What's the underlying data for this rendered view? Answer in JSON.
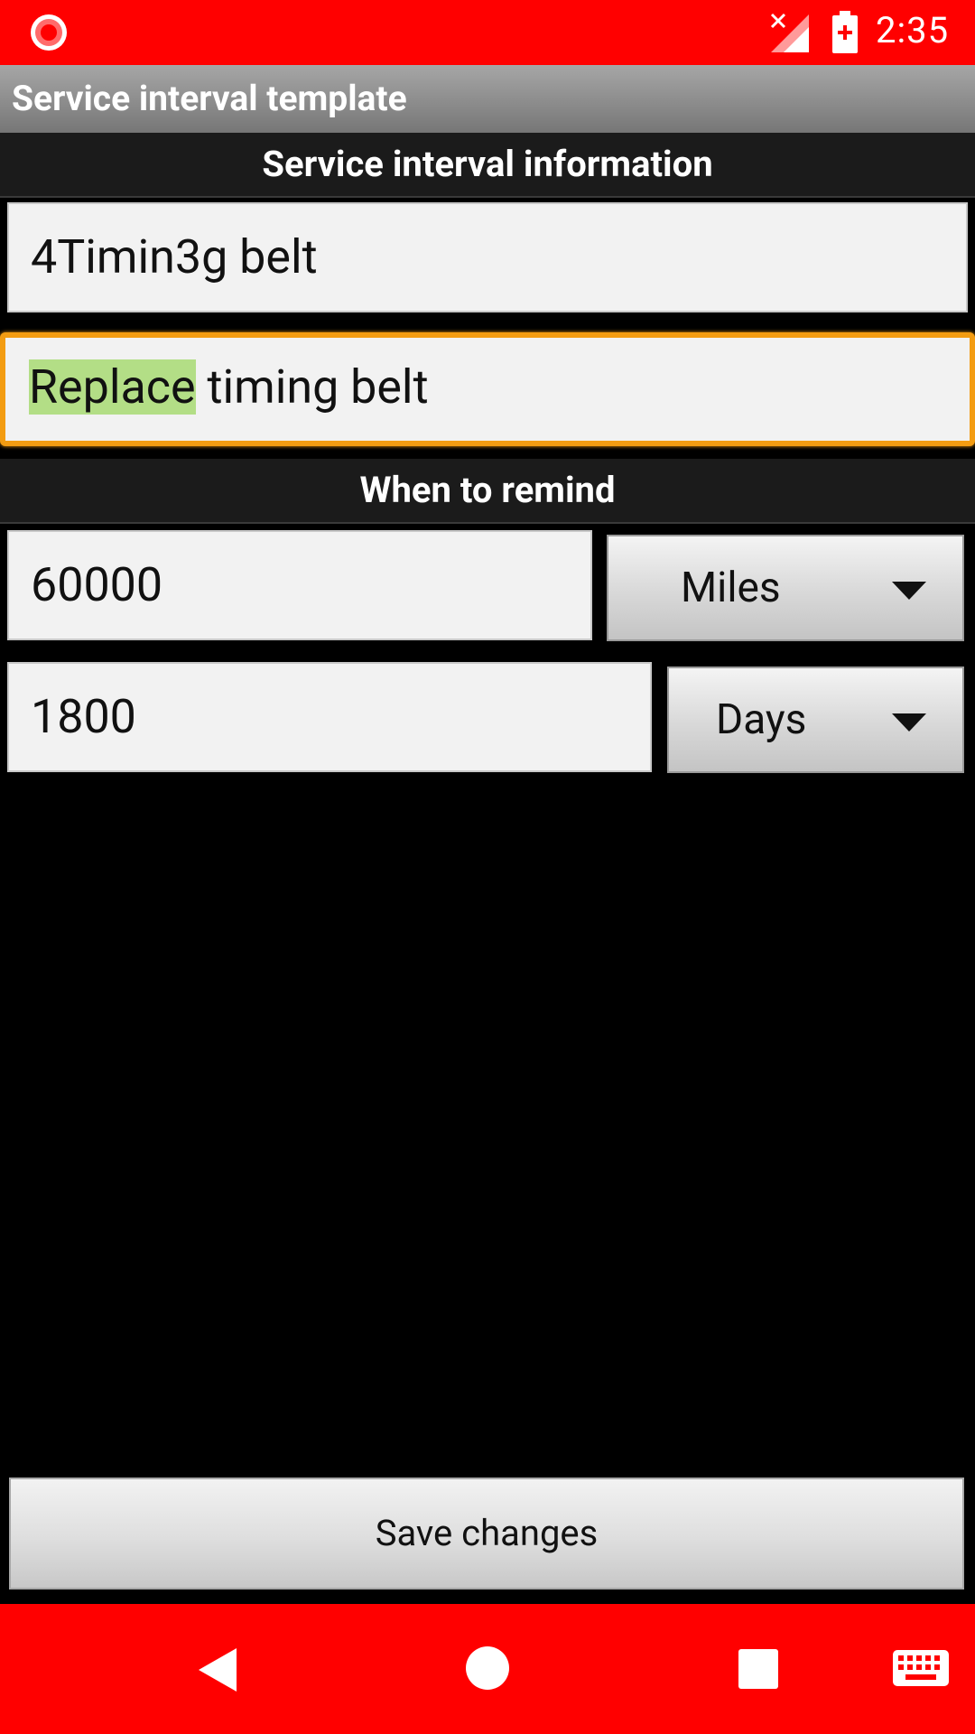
{
  "status_bar": {
    "time": "2:35",
    "icons": [
      "recording-icon",
      "signal-off-icon",
      "battery-charging-icon"
    ]
  },
  "app_bar": {
    "title": "Service interval template"
  },
  "info_section": {
    "header": "Service interval information",
    "name_value": "4Timin3g belt",
    "description_highlighted": "Replace",
    "description_rest": " timing belt"
  },
  "remind_section": {
    "header": "When to remind",
    "distance_value": "60000",
    "distance_unit": "Miles",
    "time_value": "1800",
    "time_unit": "Days"
  },
  "actions": {
    "save_label": "Save changes"
  },
  "nav_bar": {
    "icons": [
      "back-icon",
      "home-icon",
      "recents-icon",
      "keyboard-icon"
    ]
  },
  "colors": {
    "status_bar": "#ff0000",
    "focus_border": "#f39c12",
    "text_highlight": "#b3de86"
  }
}
